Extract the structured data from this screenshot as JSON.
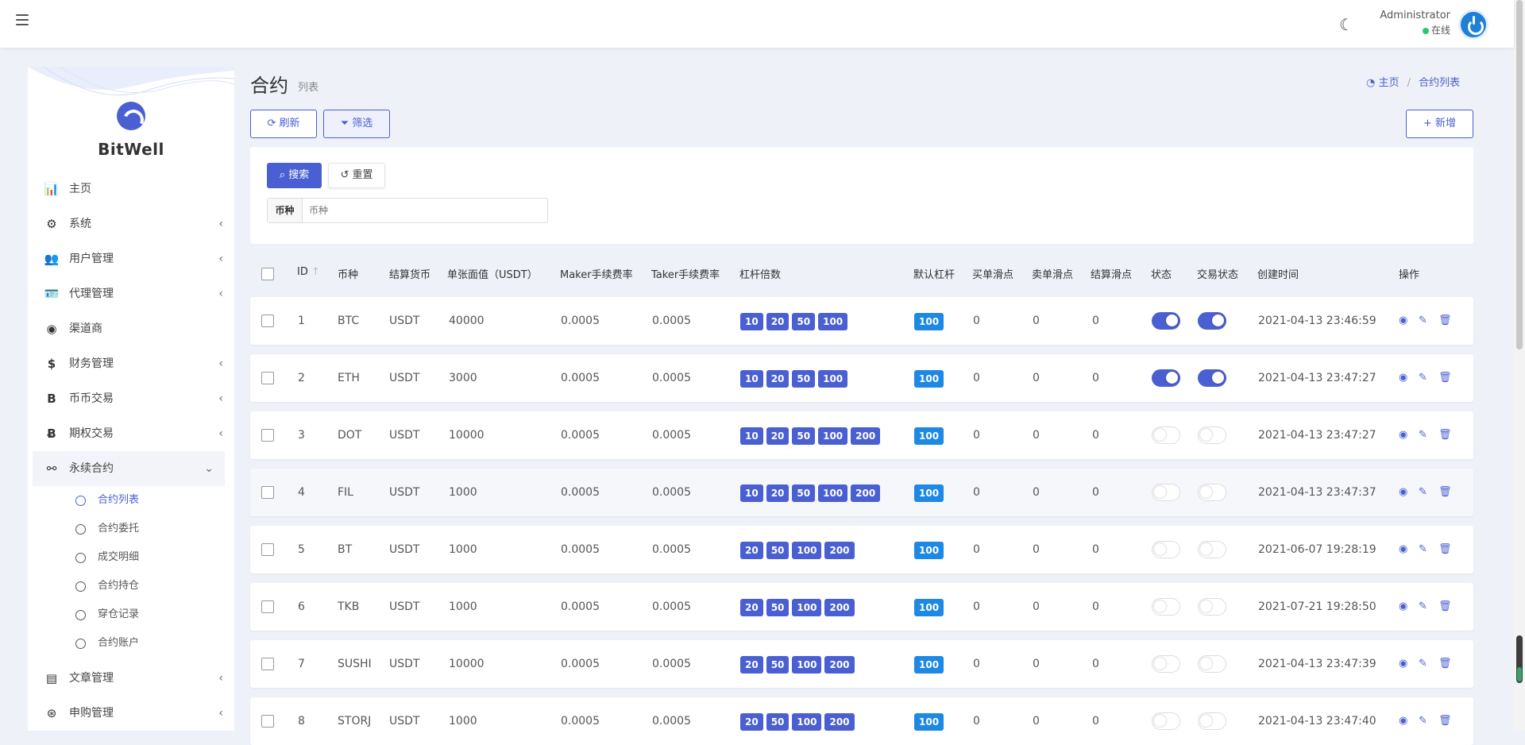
{
  "topbar": {
    "user_name": "Administrator",
    "user_status": "在线"
  },
  "brand": {
    "name": "BitWell"
  },
  "sidebar": {
    "items": [
      {
        "label": "主页",
        "icon": "bar-chart-icon",
        "expandable": false
      },
      {
        "label": "系统",
        "icon": "gear-icon",
        "expandable": true
      },
      {
        "label": "用户管理",
        "icon": "users-icon",
        "expandable": true
      },
      {
        "label": "代理管理",
        "icon": "id-card-icon",
        "expandable": true
      },
      {
        "label": "渠道商",
        "icon": "user-circle-icon",
        "expandable": false
      },
      {
        "label": "财务管理",
        "icon": "dollar-icon",
        "expandable": true
      },
      {
        "label": "币币交易",
        "icon": "bitcoin-icon",
        "expandable": true
      },
      {
        "label": "期权交易",
        "icon": "bitcoin-coin-icon",
        "expandable": true
      },
      {
        "label": "永续合约",
        "icon": "link-icon",
        "expandable": true,
        "open": true
      }
    ],
    "subitems": [
      {
        "label": "合约列表",
        "active": true
      },
      {
        "label": "合约委托"
      },
      {
        "label": "成交明细"
      },
      {
        "label": "合约持仓"
      },
      {
        "label": "穿仓记录"
      },
      {
        "label": "合约账户"
      }
    ],
    "after_items": [
      {
        "label": "文章管理",
        "icon": "newspaper-icon",
        "expandable": true
      },
      {
        "label": "申购管理",
        "icon": "lifebuoy-icon",
        "expandable": true
      }
    ]
  },
  "page": {
    "title": "合约",
    "subtitle": "列表",
    "breadcrumb_home": "主页",
    "breadcrumb_current": "合约列表"
  },
  "toolbar": {
    "refresh": "刷新",
    "filter": "筛选",
    "add": "新增"
  },
  "search": {
    "search_btn": "搜索",
    "reset_btn": "重置",
    "field_label": "币种",
    "field_placeholder": "币种"
  },
  "table": {
    "headers": {
      "id": "ID",
      "symbol": "币种",
      "settle": "结算货币",
      "face": "单张面值（USDT）",
      "maker": "Maker手续费率",
      "taker": "Taker手续费率",
      "lever": "杠杆倍数",
      "default_lever": "默认杠杆",
      "buy_slip": "买单滑点",
      "sell_slip": "卖单滑点",
      "settle_slip": "结算滑点",
      "status": "状态",
      "trade_status": "交易状态",
      "created": "创建时间",
      "ops": "操作"
    },
    "rows": [
      {
        "id": "1",
        "symbol": "BTC",
        "settle": "USDT",
        "face": "40000",
        "maker": "0.0005",
        "taker": "0.0005",
        "levers": [
          "10",
          "20",
          "50",
          "100"
        ],
        "default_lever": "100",
        "buy_slip": "0",
        "sell_slip": "0",
        "settle_slip": "0",
        "status": true,
        "trade_status": true,
        "created": "2021-04-13 23:46:59"
      },
      {
        "id": "2",
        "symbol": "ETH",
        "settle": "USDT",
        "face": "3000",
        "maker": "0.0005",
        "taker": "0.0005",
        "levers": [
          "10",
          "20",
          "50",
          "100"
        ],
        "default_lever": "100",
        "buy_slip": "0",
        "sell_slip": "0",
        "settle_slip": "0",
        "status": true,
        "trade_status": true,
        "created": "2021-04-13 23:47:27"
      },
      {
        "id": "3",
        "symbol": "DOT",
        "settle": "USDT",
        "face": "10000",
        "maker": "0.0005",
        "taker": "0.0005",
        "levers": [
          "10",
          "20",
          "50",
          "100",
          "200"
        ],
        "default_lever": "100",
        "buy_slip": "0",
        "sell_slip": "0",
        "settle_slip": "0",
        "status": false,
        "trade_status": false,
        "created": "2021-04-13 23:47:27"
      },
      {
        "id": "4",
        "symbol": "FIL",
        "settle": "USDT",
        "face": "1000",
        "maker": "0.0005",
        "taker": "0.0005",
        "levers": [
          "10",
          "20",
          "50",
          "100",
          "200"
        ],
        "default_lever": "100",
        "buy_slip": "0",
        "sell_slip": "0",
        "settle_slip": "0",
        "status": false,
        "trade_status": false,
        "created": "2021-04-13 23:47:37"
      },
      {
        "id": "5",
        "symbol": "BT",
        "settle": "USDT",
        "face": "1000",
        "maker": "0.0005",
        "taker": "0.0005",
        "levers": [
          "20",
          "50",
          "100",
          "200"
        ],
        "default_lever": "100",
        "buy_slip": "0",
        "sell_slip": "0",
        "settle_slip": "0",
        "status": false,
        "trade_status": false,
        "created": "2021-06-07 19:28:19"
      },
      {
        "id": "6",
        "symbol": "TKB",
        "settle": "USDT",
        "face": "1000",
        "maker": "0.0005",
        "taker": "0.0005",
        "levers": [
          "20",
          "50",
          "100",
          "200"
        ],
        "default_lever": "100",
        "buy_slip": "0",
        "sell_slip": "0",
        "settle_slip": "0",
        "status": false,
        "trade_status": false,
        "created": "2021-07-21 19:28:50"
      },
      {
        "id": "7",
        "symbol": "SUSHI",
        "settle": "USDT",
        "face": "10000",
        "maker": "0.0005",
        "taker": "0.0005",
        "levers": [
          "20",
          "50",
          "100",
          "200"
        ],
        "default_lever": "100",
        "buy_slip": "0",
        "sell_slip": "0",
        "settle_slip": "0",
        "status": false,
        "trade_status": false,
        "created": "2021-04-13 23:47:39"
      },
      {
        "id": "8",
        "symbol": "STORJ",
        "settle": "USDT",
        "face": "1000",
        "maker": "0.0005",
        "taker": "0.0005",
        "levers": [
          "20",
          "50",
          "100",
          "200"
        ],
        "default_lever": "100",
        "buy_slip": "0",
        "sell_slip": "0",
        "settle_slip": "0",
        "status": false,
        "trade_status": false,
        "created": "2021-04-13 23:47:40"
      }
    ]
  },
  "colors": {
    "accent": "#4a5fd1",
    "badge_blue": "#1e88e5",
    "online": "#28c76f"
  }
}
